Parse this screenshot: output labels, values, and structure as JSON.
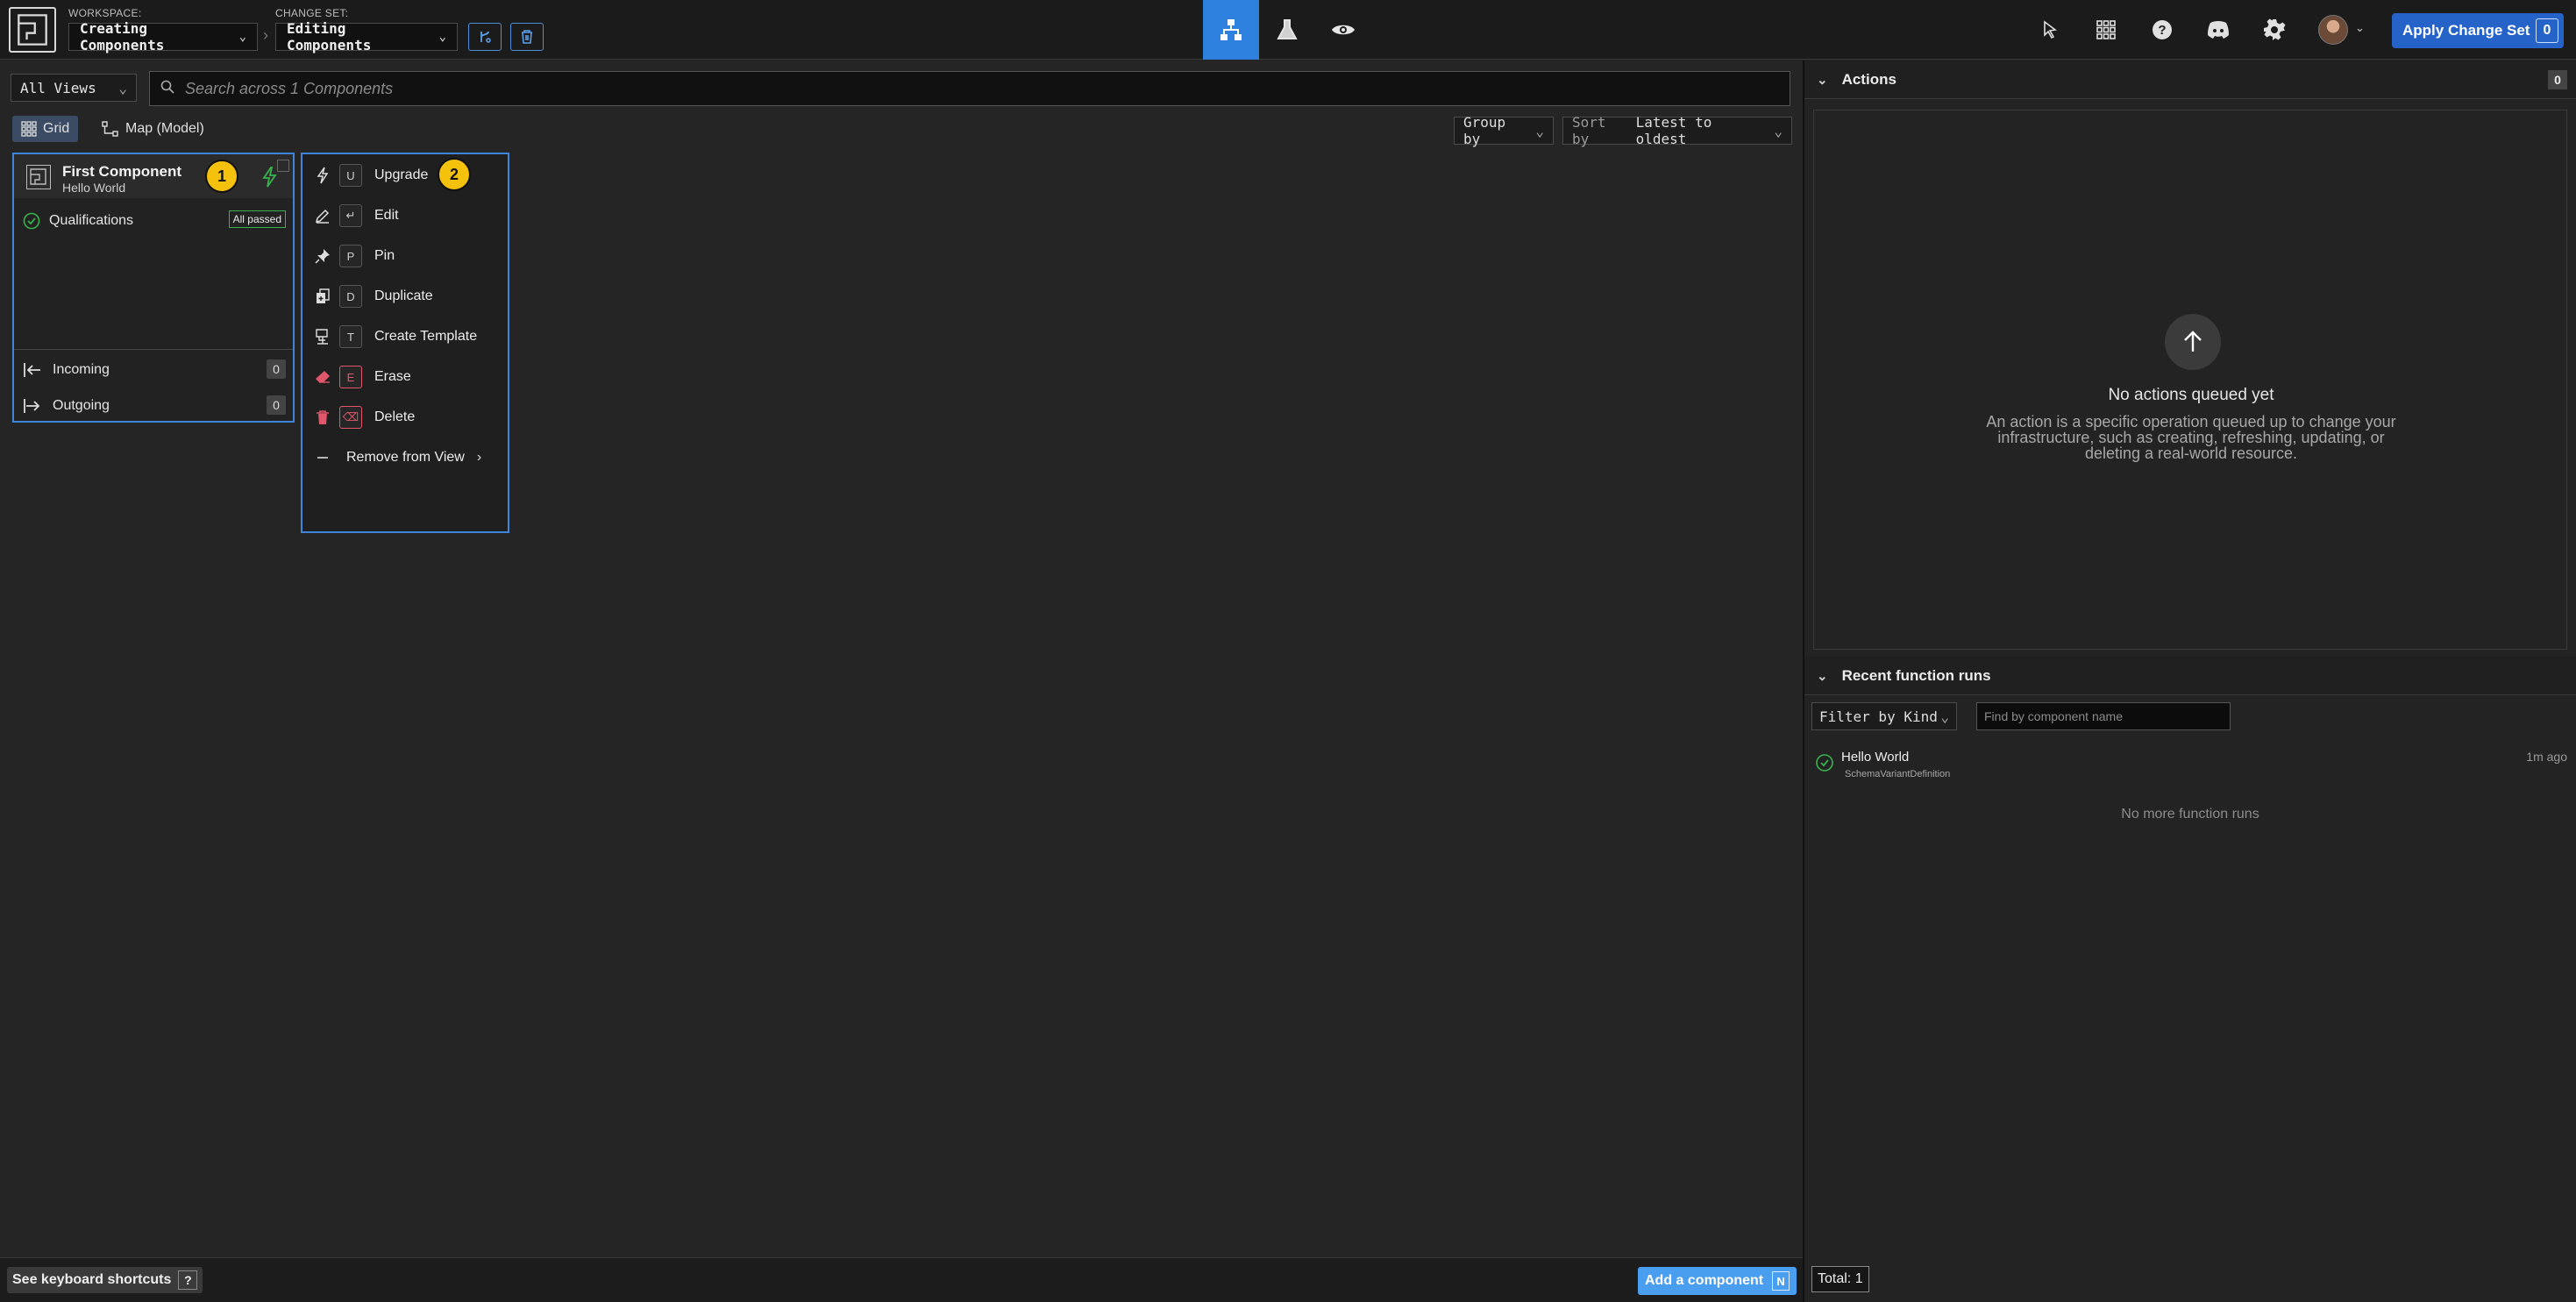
{
  "header": {
    "workspace_label": "WORKSPACE:",
    "workspace_value": "Creating Components",
    "changeset_label": "CHANGE SET:",
    "changeset_value": "Editing Components",
    "apply_label": "Apply Change Set",
    "apply_count": "0",
    "accent": "#2e80de"
  },
  "toolbar": {
    "views_select": "All Views",
    "search_placeholder": "Search across 1 Components",
    "tab_grid": "Grid",
    "tab_map": "Map (Model)",
    "group_by": "Group by",
    "sort_label": "Sort by",
    "sort_value": "Latest to oldest"
  },
  "card": {
    "title": "First Component",
    "subtitle": "Hello World",
    "qualifications": "Qualifications",
    "qual_status": "All passed",
    "incoming": "Incoming",
    "incoming_count": "0",
    "outgoing": "Outgoing",
    "outgoing_count": "0",
    "badge": "1"
  },
  "menu": {
    "badge": "2",
    "items": [
      {
        "label": "Upgrade",
        "key": "U",
        "icon": "bolt-icon"
      },
      {
        "label": "Edit",
        "key": "↵",
        "icon": "pencil-icon"
      },
      {
        "label": "Pin",
        "key": "P",
        "icon": "pin-icon"
      },
      {
        "label": "Duplicate",
        "key": "D",
        "icon": "duplicate-icon"
      },
      {
        "label": "Create Template",
        "key": "T",
        "icon": "template-icon"
      },
      {
        "label": "Erase",
        "key": "E",
        "icon": "eraser-icon"
      },
      {
        "label": "Delete",
        "key": "⌫",
        "icon": "trash-icon"
      }
    ],
    "remove_from_view": "Remove from View"
  },
  "footer": {
    "shortcuts": "See keyboard shortcuts",
    "shortcuts_key": "?",
    "add_component": "Add a component",
    "add_key": "N"
  },
  "actions": {
    "title": "Actions",
    "count": "0",
    "empty_title": "No actions queued yet",
    "empty_desc": "An action is a specific operation queued up to change your infrastructure, such as creating, refreshing, updating, or deleting a real-world resource."
  },
  "runs": {
    "title": "Recent function runs",
    "filter": "Filter by Kind",
    "find_placeholder": "Find by component name",
    "items": [
      {
        "name": "Hello World",
        "kind": "SchemaVariantDefinition",
        "time": "1m ago"
      }
    ],
    "no_more": "No more function runs",
    "total": "Total: 1"
  }
}
